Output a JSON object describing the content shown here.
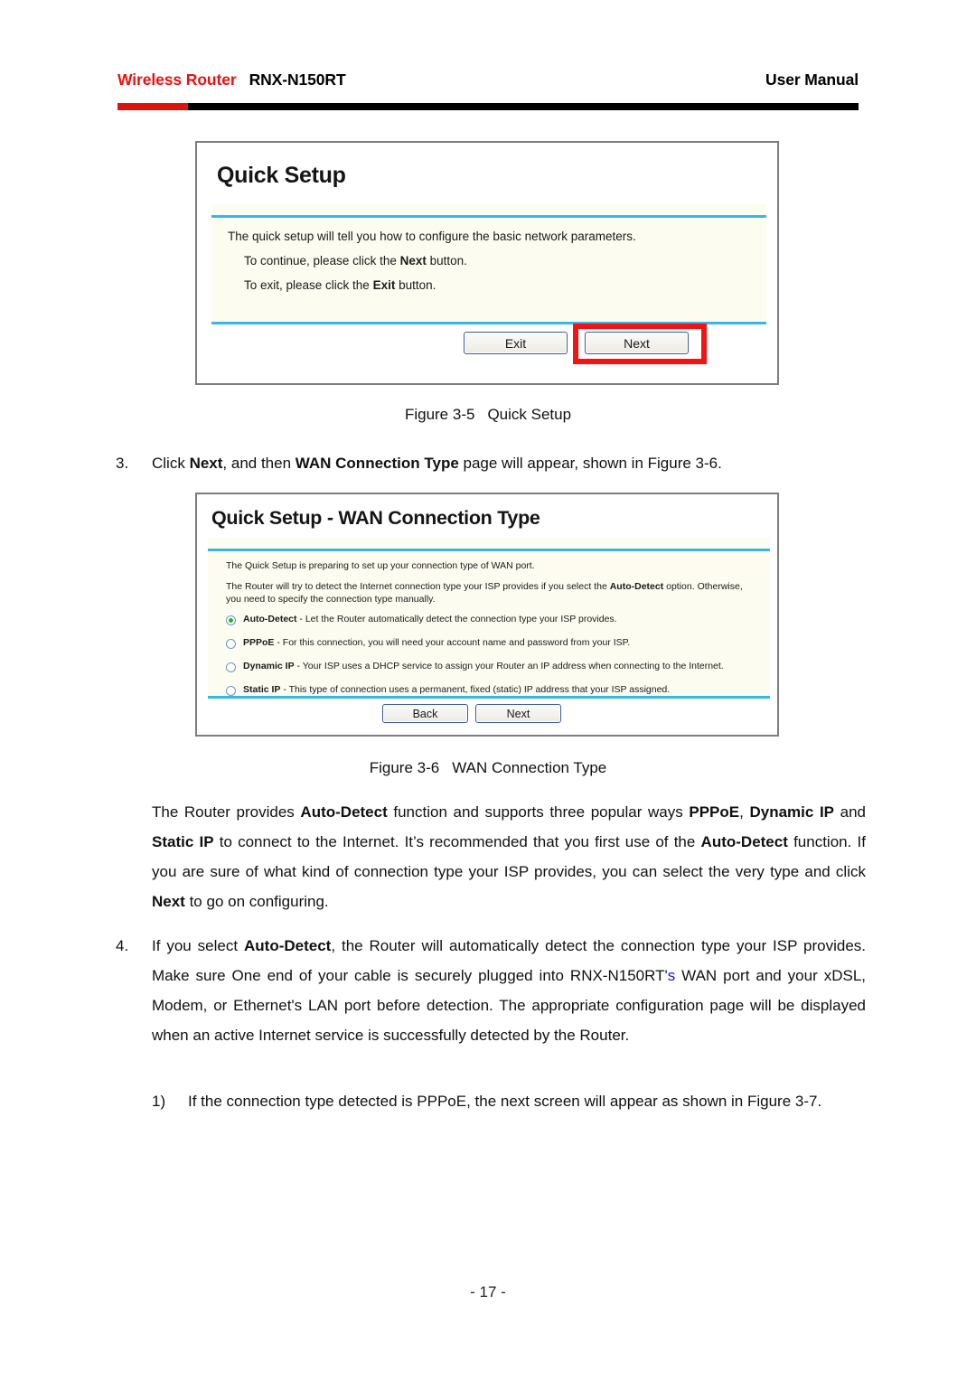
{
  "header": {
    "brand": "Wireless Router",
    "model": "RNX-N150RT",
    "doc_type": "User Manual",
    "rule_red": "#d8180e",
    "rule_black": "#000000",
    "brand_color": "#e8120c"
  },
  "figure_3_5": {
    "title": "Quick Setup",
    "line1": "The quick setup will tell you how to configure the basic network parameters.",
    "line2_pre": "To continue, please click the ",
    "line2_bold": "Next",
    "line2_post": " button.",
    "line3_pre": "To exit, please click the ",
    "line3_bold": "Exit",
    "line3_post": "  button.",
    "exit_button": "Exit",
    "next_button": "Next",
    "highlight_color": "#f41212",
    "divider_color": "#39b6e8",
    "body_background": "#fcfcf0"
  },
  "caption_3_5": {
    "label": "Figure 3-5",
    "text": "Quick Setup"
  },
  "step3": {
    "number": "3.",
    "t1": "Click ",
    "b1": "Next",
    "t2": ", and then ",
    "b2": "WAN Connection Type",
    "t3": " page will appear, shown in Figure 3-6."
  },
  "figure_3_6": {
    "title": "Quick Setup - WAN Connection Type",
    "intro1": "The Quick Setup is preparing to set up your connection type of WAN port.",
    "intro2_pre": "The Router will try to detect the Internet connection type your ISP provides if you select the ",
    "intro2_bold": "Auto-Detect",
    "intro2_post": " option. Otherwise, you need to specify the connection type manually.",
    "options": [
      {
        "id": "auto-detect",
        "label": "Auto-Detect",
        "separator": " - ",
        "description": "Let the Router automatically detect the connection type your ISP provides.",
        "selected": true
      },
      {
        "id": "pppoe",
        "label": "PPPoE",
        "separator": " - ",
        "description": "For this connection, you will need your account name and password from your ISP.",
        "selected": false
      },
      {
        "id": "dynamic-ip",
        "label": "Dynamic IP",
        "separator": " - ",
        "description": "Your ISP uses a DHCP service to assign your Router an IP address when connecting to the Internet.",
        "selected": false
      },
      {
        "id": "static-ip",
        "label": "Static IP",
        "separator": " - ",
        "description": "This type of connection uses a permanent, fixed (static) IP address that your ISP assigned.",
        "selected": false
      }
    ],
    "back_button": "Back",
    "next_button": "Next",
    "selected_dot_color": "#22b422",
    "divider_color": "#39b6e8"
  },
  "caption_3_6": {
    "label": "Figure 3-6",
    "text": "WAN Connection Type"
  },
  "paragraph_1": {
    "t1": "The Router provides ",
    "b1": "Auto-Detect",
    "t2": " function and supports three popular ways ",
    "b2": "PPPoE",
    "t3": ", ",
    "b3": "Dynamic IP",
    "t4": " and ",
    "b4": "Static IP",
    "t5": " to connect to the Internet. It’s recommended that you first use of the ",
    "b5": "Auto-Detect",
    "t6": " function. If you are sure of what kind of connection type your ISP provides, you can select the very type and click ",
    "b6": "Next",
    "t7": " to go on configuring."
  },
  "step4": {
    "number": "4.",
    "t1": "If you select ",
    "b1": "Auto-Detect",
    "t2": ", the Router will automatically detect the connection type your ISP provides. Make sure One end of your cable is securely plugged into RNX-N150RT",
    "blue": "'s",
    "t3": " WAN port and your xDSL, Modem, or Ethernet's LAN port before detection. The appropriate configuration page will be displayed when an active Internet service is successfully detected by the Router.",
    "blue_color": "#1515e0"
  },
  "substep1": {
    "number": "1)",
    "text": "If the connection type detected is PPPoE, the next screen will appear as shown in Figure 3-7."
  },
  "footer": {
    "page_number": "- 17 -"
  }
}
